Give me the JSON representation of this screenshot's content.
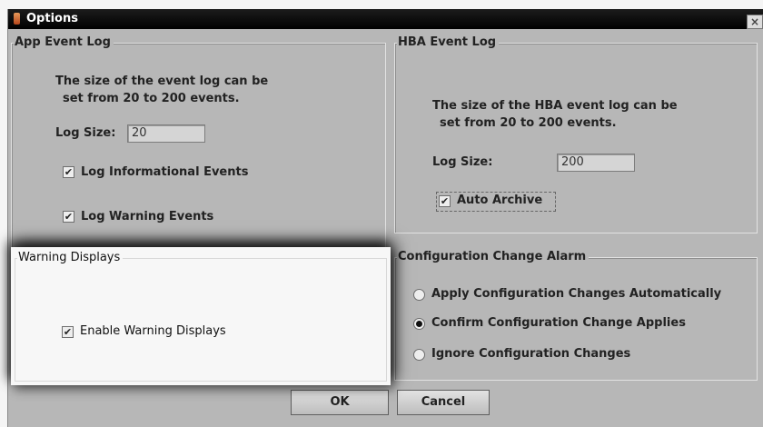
{
  "window": {
    "title": "Options",
    "close_symbol": "×"
  },
  "app_event_log": {
    "title": "App Event Log",
    "description_line1": "The size of the event log can be",
    "description_line2": "set from 20 to 200 events.",
    "log_size_label": "Log Size:",
    "log_size_value": "20",
    "log_informational_label": "Log Informational Events",
    "log_informational_checked": true,
    "log_warning_label": "Log Warning Events",
    "log_warning_checked": true
  },
  "hba_event_log": {
    "title": "HBA Event Log",
    "description_line1": "The size of the HBA event log can be",
    "description_line2": "set from 20 to 200 events.",
    "log_size_label": "Log Size:",
    "log_size_value": "200",
    "auto_archive_label": "Auto Archive",
    "auto_archive_checked": true
  },
  "warning_displays": {
    "title": "Warning Displays",
    "enable_label": "Enable Warning Displays",
    "enable_checked": true
  },
  "configuration_change_alarm": {
    "title": "Configuration Change Alarm",
    "options": [
      {
        "label": "Apply Configuration Changes Automatically",
        "selected": false
      },
      {
        "label": "Confirm Configuration Change Applies",
        "selected": true
      },
      {
        "label": "Ignore Configuration Changes",
        "selected": false
      }
    ]
  },
  "buttons": {
    "ok": "OK",
    "cancel": "Cancel"
  },
  "icons": {
    "window_icon": "app-icon",
    "close": "close-icon",
    "check": "checkmark-icon"
  },
  "check_glyph": "✔"
}
